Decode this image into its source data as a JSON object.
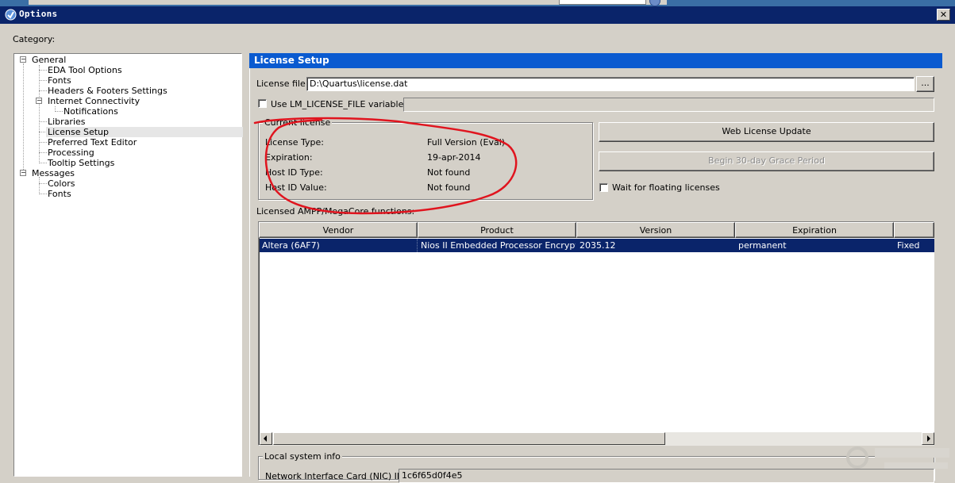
{
  "window": {
    "title": "Options",
    "close_glyph": "✕"
  },
  "category_label": "Category:",
  "tree": {
    "items": [
      {
        "label": "General"
      },
      {
        "label": "EDA Tool Options"
      },
      {
        "label": "Fonts"
      },
      {
        "label": "Headers & Footers Settings"
      },
      {
        "label": "Internet Connectivity"
      },
      {
        "label": "Notifications"
      },
      {
        "label": "Libraries"
      },
      {
        "label": "License Setup",
        "selected": true
      },
      {
        "label": "Preferred Text Editor"
      },
      {
        "label": "Processing"
      },
      {
        "label": "Tooltip Settings"
      },
      {
        "label": "Messages"
      },
      {
        "label": "Colors"
      },
      {
        "label": "Fonts"
      }
    ]
  },
  "panel": {
    "title": "License Setup",
    "license_file": {
      "label": "License file:",
      "value": "D:\\Quartus\\license.dat",
      "browse_label": "..."
    },
    "lm_license": {
      "label": "Use LM_LICENSE_FILE variable:",
      "checked": false,
      "value": ""
    },
    "current_license": {
      "legend": "Current license",
      "rows": [
        {
          "label": "License Type:",
          "value": "Full Version (Eval)"
        },
        {
          "label": "Expiration:",
          "value": "19-apr-2014"
        },
        {
          "label": "Host ID Type:",
          "value": "Not found"
        },
        {
          "label": "Host ID Value:",
          "value": "Not found"
        }
      ]
    },
    "buttons": {
      "web_update": "Web License Update",
      "grace_period": "Begin 30-day Grace Period"
    },
    "wait_floating": {
      "label": "Wait for floating licenses",
      "checked": false
    },
    "functions_label": "Licensed AMPP/MegaCore functions:",
    "table": {
      "columns": [
        "Vendor",
        "Product",
        "Version",
        "Expiration",
        ""
      ],
      "rows": [
        [
          "Altera (6AF7)",
          "Nios II Embedded Processor Encrypte...",
          "2035.12",
          "permanent",
          "Fixed"
        ]
      ]
    },
    "local_system": {
      "legend": "Local system info",
      "nic_label": "Network Interface Card (NIC) ID:",
      "nic_value": "1c6f65d0f4e5"
    }
  },
  "colors": {
    "titlebar": "#0a246a",
    "panel_header": "#0a5ad0",
    "selection": "#0a246a",
    "annotation": "#e0141e"
  }
}
